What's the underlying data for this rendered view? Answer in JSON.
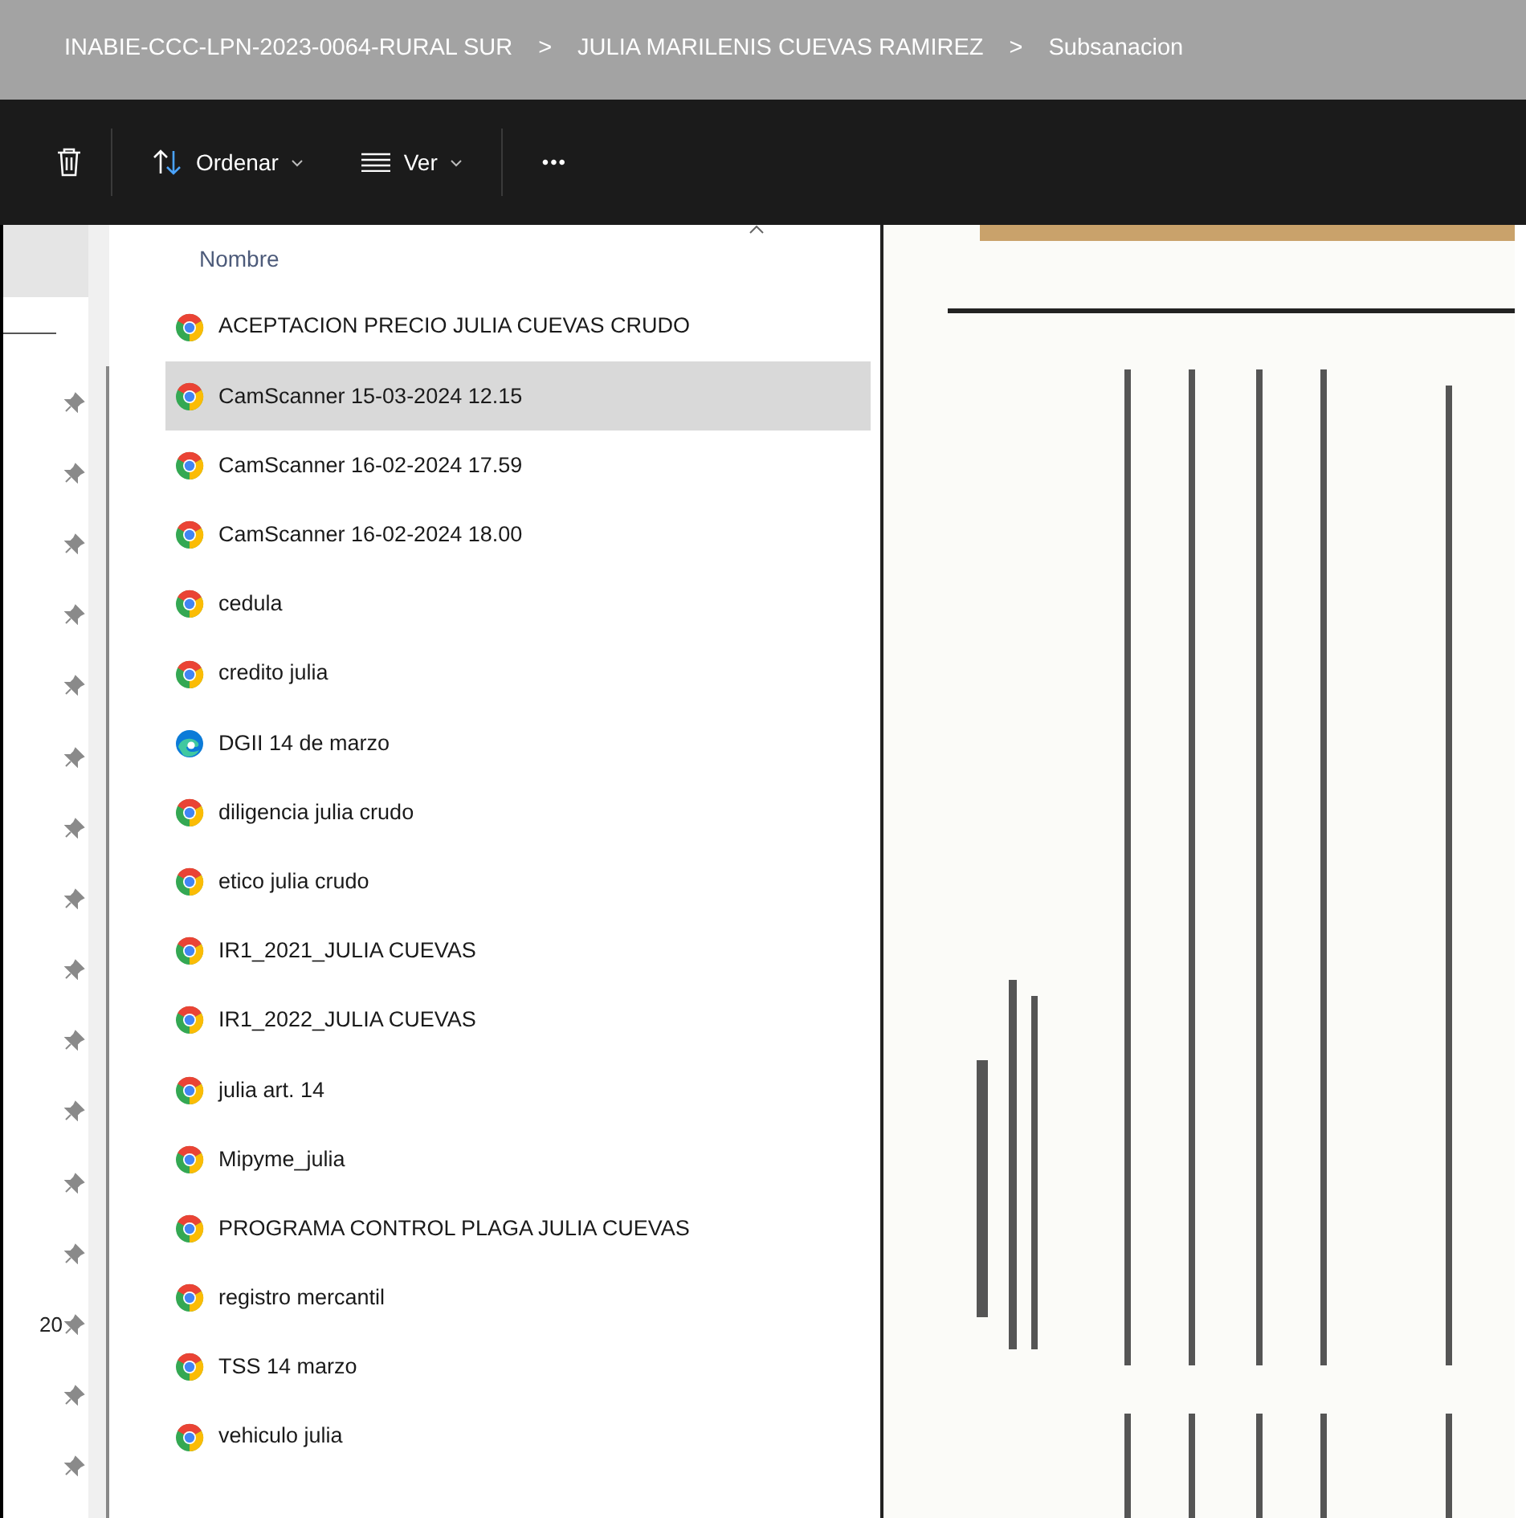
{
  "breadcrumb": [
    "INABIE-CCC-LPN-2023-0064-RURAL SUR",
    "JULIA MARILENIS CUEVAS RAMIREZ",
    "Subsanacion"
  ],
  "breadcrumb_separator": ">",
  "toolbar": {
    "sort_label": "Ordenar",
    "view_label": "Ver",
    "more_label": "•••"
  },
  "nav_items": [
    {
      "pinned": true
    },
    {
      "pinned": true
    },
    {
      "pinned": true
    },
    {
      "pinned": true
    },
    {
      "pinned": true
    },
    {
      "pinned": true
    },
    {
      "pinned": true
    },
    {
      "pinned": true
    },
    {
      "pinned": true
    },
    {
      "pinned": true
    },
    {
      "pinned": true
    },
    {
      "pinned": true
    },
    {
      "pinned": true
    },
    {
      "pinned": true,
      "text": "20"
    },
    {
      "pinned": true
    },
    {
      "pinned": true
    }
  ],
  "file_list": {
    "column": "Nombre",
    "files": [
      {
        "name": "ACEPTACION PRECIO JULIA CUEVAS CRUDO",
        "kind": "chrome",
        "selected": false
      },
      {
        "name": "CamScanner 15-03-2024 12.15",
        "kind": "chrome",
        "selected": true
      },
      {
        "name": "CamScanner 16-02-2024 17.59",
        "kind": "chrome",
        "selected": false
      },
      {
        "name": "CamScanner 16-02-2024 18.00",
        "kind": "chrome",
        "selected": false
      },
      {
        "name": "cedula",
        "kind": "chrome",
        "selected": false
      },
      {
        "name": "credito julia",
        "kind": "chrome",
        "selected": false
      },
      {
        "name": "DGII 14 de marzo",
        "kind": "edge",
        "selected": false
      },
      {
        "name": "diligencia julia crudo",
        "kind": "chrome",
        "selected": false
      },
      {
        "name": "etico julia crudo",
        "kind": "chrome",
        "selected": false
      },
      {
        "name": "IR1_2021_JULIA CUEVAS",
        "kind": "chrome",
        "selected": false
      },
      {
        "name": "IR1_2022_JULIA CUEVAS",
        "kind": "chrome",
        "selected": false
      },
      {
        "name": "julia art. 14",
        "kind": "chrome",
        "selected": false
      },
      {
        "name": "Mipyme_julia",
        "kind": "chrome",
        "selected": false
      },
      {
        "name": "PROGRAMA CONTROL PLAGA JULIA CUEVAS",
        "kind": "chrome",
        "selected": false
      },
      {
        "name": "registro mercantil",
        "kind": "chrome",
        "selected": false
      },
      {
        "name": "TSS 14 marzo",
        "kind": "chrome",
        "selected": false
      },
      {
        "name": "vehiculo julia",
        "kind": "chrome",
        "selected": false
      }
    ]
  }
}
